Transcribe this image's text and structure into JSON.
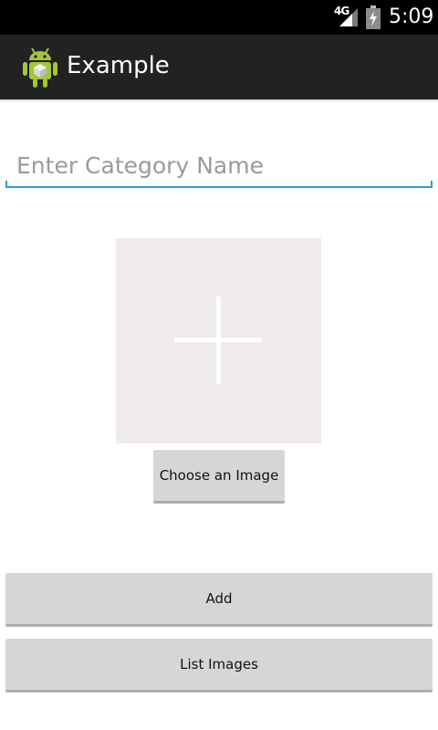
{
  "status_bar": {
    "network_type": "4G",
    "time": "5:09",
    "icons": [
      "signal-icon",
      "battery-icon"
    ]
  },
  "action_bar": {
    "title": "Example",
    "icon": "android-robot-icon"
  },
  "form": {
    "category_placeholder": "Enter Category Name",
    "category_value": "",
    "image_placeholder_icon": "plus-icon",
    "choose_image_label": "Choose an Image",
    "add_label": "Add",
    "list_images_label": "List Images"
  },
  "colors": {
    "status_bar_bg": "#000000",
    "action_bar_bg": "#222222",
    "input_underline": "#2c9bd4",
    "image_placeholder_bg": "#efebed",
    "button_bg": "#d6d6d6"
  }
}
